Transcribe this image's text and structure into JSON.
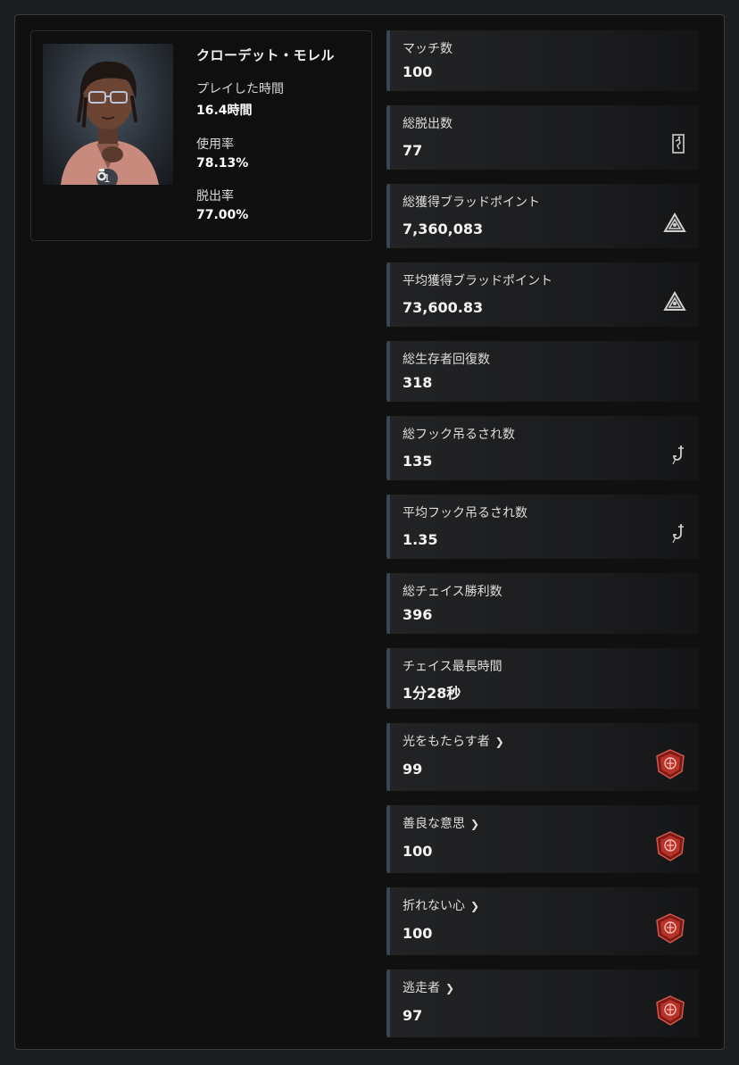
{
  "character": {
    "name": "クローデット・モレル",
    "level": "1",
    "fields": [
      {
        "label": "プレイした時間",
        "value": "16.4時間"
      },
      {
        "label": "使用率",
        "value": "78.13%"
      },
      {
        "label": "脱出率",
        "value": "77.00%"
      }
    ]
  },
  "stats": [
    {
      "label": "マッチ数",
      "value": "100",
      "icon": "none"
    },
    {
      "label": "総脱出数",
      "value": "77",
      "icon": "exit-door-icon"
    },
    {
      "label": "総獲得ブラッドポイント",
      "value": "7,360,083",
      "icon": "bloodpoints-icon"
    },
    {
      "label": "平均獲得ブラッドポイント",
      "value": "73,600.83",
      "icon": "bloodpoints-icon"
    },
    {
      "label": "総生存者回復数",
      "value": "318",
      "icon": "none"
    },
    {
      "label": "総フック吊るされ数",
      "value": "135",
      "icon": "hook-icon"
    },
    {
      "label": "平均フック吊るされ数",
      "value": "1.35",
      "icon": "hook-icon"
    },
    {
      "label": "総チェイス勝利数",
      "value": "396",
      "icon": "none"
    },
    {
      "label": "チェイス最長時間",
      "value": "1分28秒",
      "icon": "none"
    },
    {
      "label": "光をもたらす者",
      "value": "99",
      "icon": "achievement-emblem-icon",
      "link": true
    },
    {
      "label": "善良な意思",
      "value": "100",
      "icon": "achievement-emblem-icon",
      "link": true
    },
    {
      "label": "折れない心",
      "value": "100",
      "icon": "achievement-emblem-icon",
      "link": true
    },
    {
      "label": "逃走者",
      "value": "97",
      "icon": "achievement-emblem-icon",
      "link": true
    }
  ],
  "colors": {
    "accent_bar": "#3a4456",
    "emblem_red": "#b8322a"
  }
}
